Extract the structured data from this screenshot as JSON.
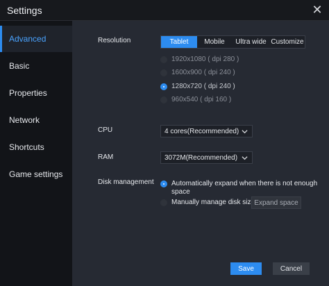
{
  "window": {
    "title": "Settings",
    "close_glyph": "✕"
  },
  "sidebar": {
    "items": [
      {
        "label": "Advanced",
        "active": true
      },
      {
        "label": "Basic",
        "active": false
      },
      {
        "label": "Properties",
        "active": false
      },
      {
        "label": "Network",
        "active": false
      },
      {
        "label": "Shortcuts",
        "active": false
      },
      {
        "label": "Game settings",
        "active": false
      }
    ]
  },
  "resolution": {
    "label": "Resolution",
    "tabs": [
      {
        "label": "Tablet",
        "active": true
      },
      {
        "label": "Mobile",
        "active": false
      },
      {
        "label": "Ultra wide",
        "active": false
      },
      {
        "label": "Customize",
        "active": false
      }
    ],
    "options": [
      {
        "label": "1920x1080 ( dpi 280 )",
        "selected": false
      },
      {
        "label": "1600x900 ( dpi 240 )",
        "selected": false
      },
      {
        "label": "1280x720 ( dpi 240 )",
        "selected": true
      },
      {
        "label": "960x540 ( dpi 160 )",
        "selected": false
      }
    ]
  },
  "cpu": {
    "label": "CPU",
    "value": "4 cores(Recommended)"
  },
  "ram": {
    "label": "RAM",
    "value": "3072M(Recommended)"
  },
  "disk": {
    "label": "Disk management",
    "auto_label_line1": "Automatically expand when there is not enough",
    "auto_label_line2": "space",
    "manual_label": "Manually manage disk size",
    "expand_button": "Expand space",
    "selected": "auto"
  },
  "footer": {
    "save_label": "Save",
    "cancel_label": "Cancel"
  },
  "colors": {
    "accent": "#2d8cf0",
    "sidebar_bg": "#121418",
    "main_bg": "#262a33"
  },
  "icons": {
    "close": "close-icon",
    "dropdown": "chevron-down-icon"
  }
}
